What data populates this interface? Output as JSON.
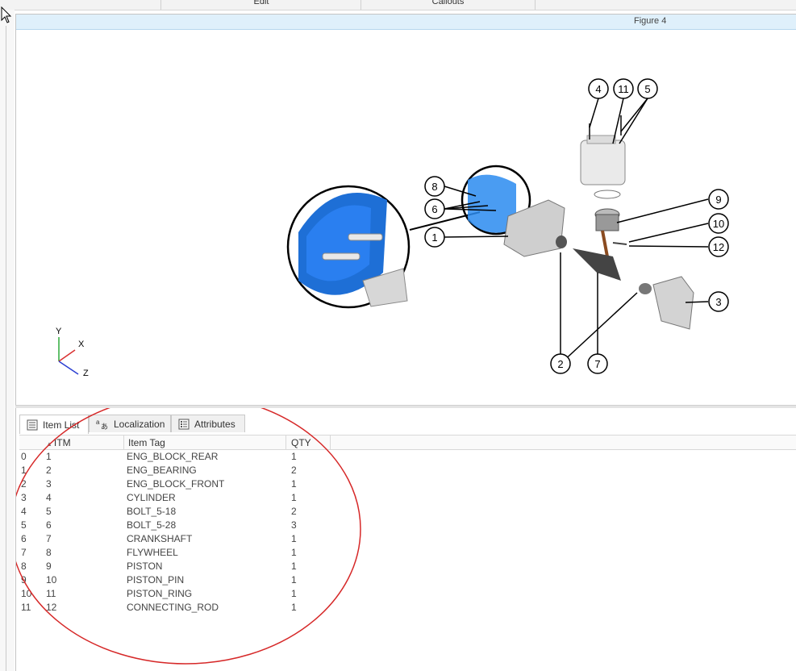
{
  "toolbar": {
    "edit_label": "Edit",
    "callouts_label": "Callouts"
  },
  "figure": {
    "title": "Figure 4"
  },
  "axes": {
    "y": "Y",
    "x": "X",
    "z": "Z"
  },
  "callouts": [
    "4",
    "11",
    "5",
    "8",
    "6",
    "1",
    "9",
    "10",
    "12",
    "3",
    "2",
    "7"
  ],
  "tabs": [
    {
      "label": "Item List",
      "icon": "list-icon"
    },
    {
      "label": "Localization",
      "icon": "translate-icon"
    },
    {
      "label": "Attributes",
      "icon": "attributes-icon"
    }
  ],
  "table": {
    "headers": [
      "ITM",
      "Item Tag",
      "QTY"
    ],
    "rows": [
      [
        "0",
        "1",
        "ENG_BLOCK_REAR",
        "1"
      ],
      [
        "1",
        "2",
        "ENG_BEARING",
        "2"
      ],
      [
        "2",
        "3",
        "ENG_BLOCK_FRONT",
        "1"
      ],
      [
        "3",
        "4",
        "CYLINDER",
        "1"
      ],
      [
        "4",
        "5",
        "BOLT_5-18",
        "2"
      ],
      [
        "5",
        "6",
        "BOLT_5-28",
        "3"
      ],
      [
        "6",
        "7",
        "CRANKSHAFT",
        "1"
      ],
      [
        "7",
        "8",
        "FLYWHEEL",
        "1"
      ],
      [
        "8",
        "9",
        "PISTON",
        "1"
      ],
      [
        "9",
        "10",
        "PISTON_PIN",
        "1"
      ],
      [
        "10",
        "11",
        "PISTON_RING",
        "1"
      ],
      [
        "11",
        "12",
        "CONNECTING_ROD",
        "1"
      ]
    ]
  },
  "colors": {
    "accent_blue": "#1e6fd6",
    "highlight_oval": "#d62828",
    "figure_bar": "#dff0fb"
  }
}
